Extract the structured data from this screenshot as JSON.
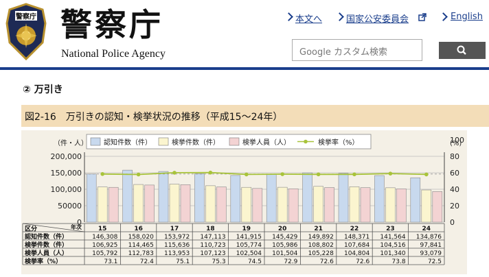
{
  "header": {
    "logo_jp": "警察庁",
    "logo_en": "National Police Agency",
    "emblem_text": "警察庁",
    "links": [
      {
        "label": "本文へ"
      },
      {
        "label": "国家公安委員会"
      },
      {
        "label": "English"
      }
    ],
    "search_placeholder": "Google カスタム検索"
  },
  "section": {
    "title": "② 万引き"
  },
  "figure": {
    "title": "図2-16　万引きの認知・検挙状況の推移（平成15～24年）"
  },
  "colors": {
    "brand_blue": "#1a3e8c",
    "fig_bar": "#f3ddb8",
    "bar_ninchi": "#c8d9ee",
    "bar_kenkyo": "#fbf5cf",
    "bar_jinin": "#f3d3d3",
    "line_rate": "#a8c33a"
  },
  "chart_data": {
    "type": "bar",
    "left_unit": "（件・人）",
    "right_unit": "(%)",
    "left_ticks": [
      "200,000",
      "150,000",
      "100,000",
      "50000",
      "0"
    ],
    "right_ticks": [
      "100",
      "80",
      "60",
      "40",
      "20",
      "0"
    ],
    "ylim": [
      0,
      200000
    ],
    "y2lim": [
      0,
      100
    ],
    "categories": [
      "15",
      "16",
      "17",
      "18",
      "19",
      "20",
      "21",
      "22",
      "23",
      "24"
    ],
    "series": [
      {
        "name": "認知件数（件）",
        "type": "bar",
        "values": [
          146308,
          158020,
          153972,
          147113,
          141915,
          145429,
          149892,
          148371,
          141564,
          134876
        ]
      },
      {
        "name": "検挙件数（件）",
        "type": "bar",
        "values": [
          106925,
          114465,
          115636,
          110723,
          105774,
          105986,
          108802,
          107684,
          104516,
          97841
        ]
      },
      {
        "name": "検挙人員（人）",
        "type": "bar",
        "values": [
          105792,
          112783,
          113953,
          107123,
          102504,
          101504,
          105228,
          104804,
          101340,
          93079
        ]
      },
      {
        "name": "検挙率（%）",
        "type": "line",
        "axis": "right",
        "values": [
          73.1,
          72.4,
          75.1,
          75.3,
          72.5,
          72.9,
          72.6,
          72.6,
          73.8,
          72.5
        ]
      }
    ],
    "table": {
      "header_kubun": "区分",
      "header_nenji": "年次",
      "rows": [
        {
          "label": "認知件数（件）",
          "cells": [
            "146,308",
            "158,020",
            "153,972",
            "147,113",
            "141,915",
            "145,429",
            "149,892",
            "148,371",
            "141,564",
            "134,876"
          ]
        },
        {
          "label": "検挙件数（件）",
          "cells": [
            "106,925",
            "114,465",
            "115,636",
            "110,723",
            "105,774",
            "105,986",
            "108,802",
            "107,684",
            "104,516",
            "97,841"
          ]
        },
        {
          "label": "検挙人員（人）",
          "cells": [
            "105,792",
            "112,783",
            "113,953",
            "107,123",
            "102,504",
            "101,504",
            "105,228",
            "104,804",
            "101,340",
            "93,079"
          ]
        },
        {
          "label": "検挙率（%）",
          "cells": [
            "73.1",
            "72.4",
            "75.1",
            "75.3",
            "74.5",
            "72.9",
            "72.6",
            "72.6",
            "73.8",
            "72.5"
          ]
        }
      ]
    }
  }
}
